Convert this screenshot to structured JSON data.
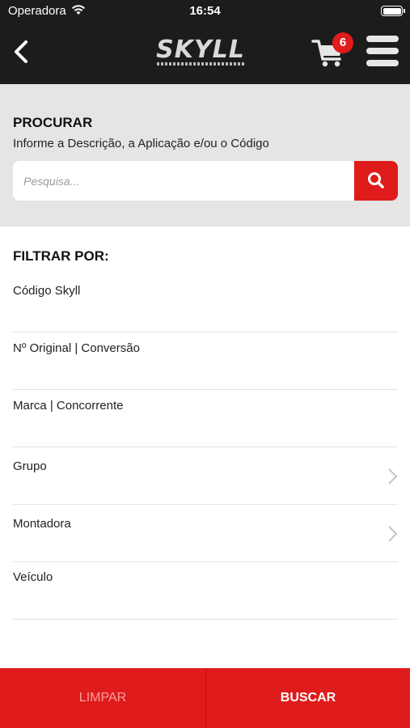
{
  "status_bar": {
    "carrier": "Operadora",
    "time": "16:54"
  },
  "header": {
    "logo_text": "SKYLL",
    "cart_count": "6"
  },
  "search": {
    "title": "PROCURAR",
    "subtitle": "Informe a Descrição, a Aplicação e/ou o Código",
    "placeholder": "Pesquisa..."
  },
  "filters": {
    "title": "FILTRAR POR:",
    "items": [
      {
        "label": "Código Skyll",
        "chevron": false
      },
      {
        "label": "Nº Original | Conversão",
        "chevron": false
      },
      {
        "label": "Marca | Concorrente",
        "chevron": false
      },
      {
        "label": "Grupo",
        "chevron": true
      },
      {
        "label": "Montadora",
        "chevron": true
      },
      {
        "label": "Veículo",
        "chevron": false
      }
    ]
  },
  "actions": {
    "clear_label": "LIMPAR",
    "search_label": "BUSCAR"
  },
  "colors": {
    "accent": "#e01b1b",
    "header_bg": "#1c1c1c",
    "search_bg": "#e5e5e5"
  }
}
